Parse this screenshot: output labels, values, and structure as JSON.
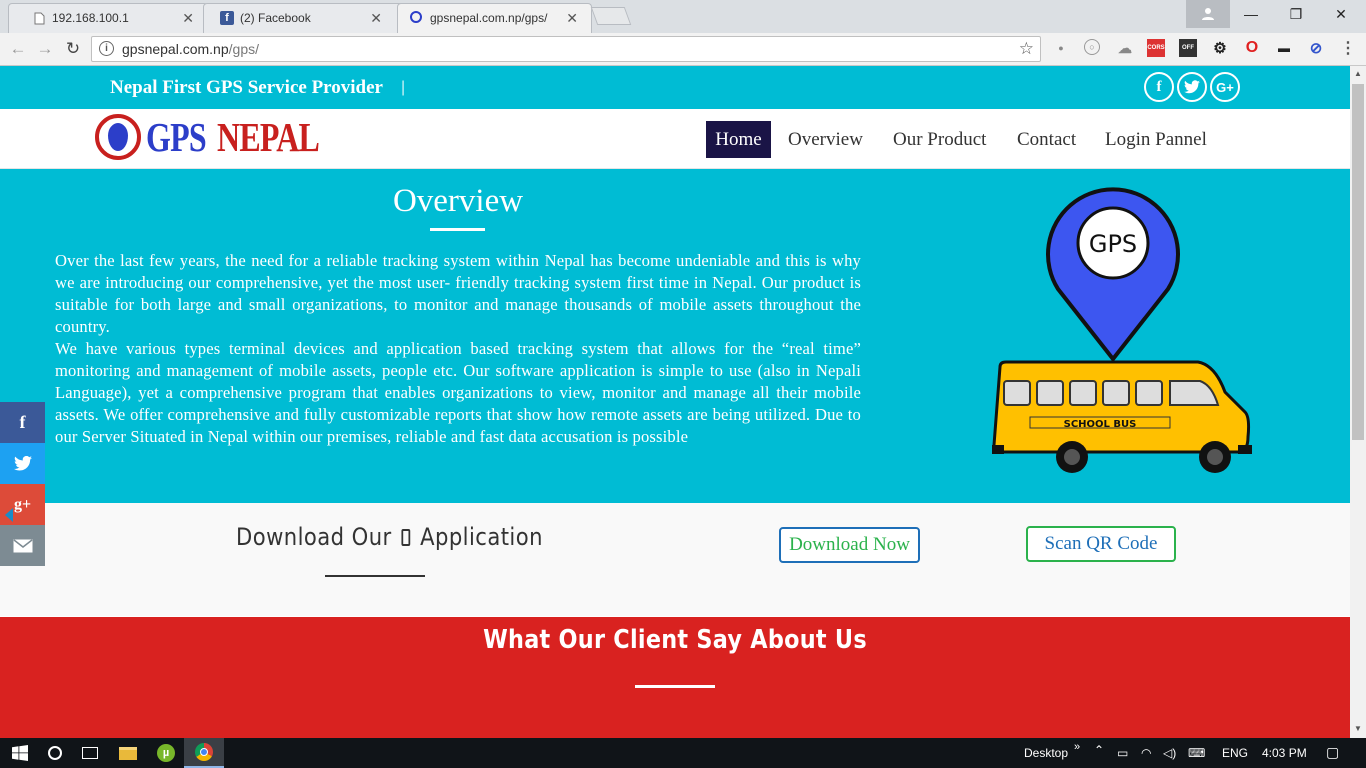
{
  "browser": {
    "tabs": [
      {
        "title": "192.168.100.1",
        "icon": "page-icon",
        "active": false
      },
      {
        "title": "(2) Facebook",
        "icon": "facebook-icon",
        "active": false
      },
      {
        "title": "gpsnepal.com.np/gps/",
        "icon": "site-icon",
        "active": true
      }
    ],
    "url_host": "gpsnepal.com.np",
    "url_path": "/gps/",
    "extensions": [
      "cors",
      "off"
    ]
  },
  "site": {
    "tagline": "Nepal First GPS Service Provider",
    "tagline_separator": "|",
    "logo_gps": "GPS",
    "logo_nepal": "NEPAL",
    "nav": [
      "Home",
      "Overview",
      "Our Product",
      "Contact",
      "Login Pannel"
    ],
    "overview": {
      "title": "Overview",
      "paragraph1": "Over the last few years, the need for a reliable tracking system within Nepal has become undeniable and this is why we are introducing our comprehensive, yet the most user- friendly tracking system first time in Nepal. Our product is suitable for both large and small organizations, to monitor and manage thousands of mobile assets throughout the country.",
      "paragraph2": "We have various types terminal devices and application based tracking system that allows for the “real time” monitoring and management of mobile assets, people etc. Our software application is simple to use (also in Nepali Language), yet a comprehensive program that enables organizations to view, monitor and manage all their mobile assets. We offer comprehensive and fully customizable reports that show how remote assets are being utilized. Due to our Server Situated in Nepal within our premises, reliable and fast data accusation is possible"
    },
    "illustration": {
      "pin_text": "GPS",
      "bus_text": "SCHOOL BUS"
    },
    "download": {
      "title_before": "Download Our",
      "title_after": "Application",
      "download_button": "Download Now",
      "qr_button": "Scan QR Code"
    },
    "clients": {
      "title": "What Our Client Say About Us"
    }
  },
  "taskbar": {
    "desktop_label": "Desktop",
    "language": "ENG",
    "time": "4:03 PM"
  },
  "colors": {
    "cyan": "#00bcd4",
    "red": "#d92220",
    "navy": "#1a1446",
    "blue": "#2c3ec9"
  }
}
